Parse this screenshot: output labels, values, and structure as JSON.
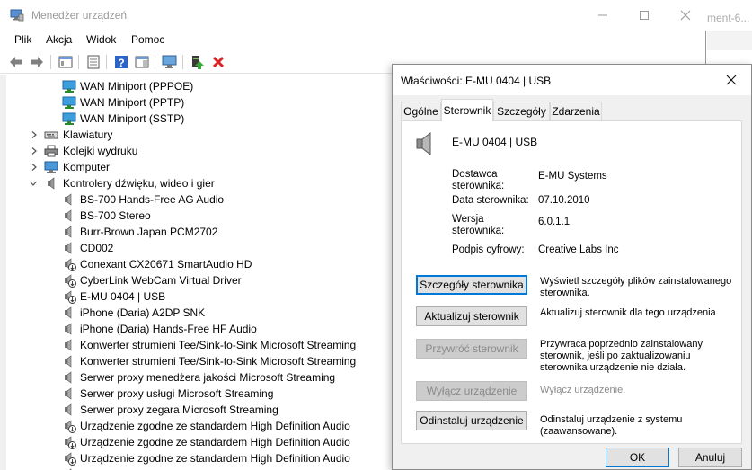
{
  "main_window": {
    "title": "Menedżer urządzeń",
    "menu": [
      "Plik",
      "Akcja",
      "Widok",
      "Pomoc"
    ]
  },
  "background_window": {
    "title": "ment-6..."
  },
  "tree": {
    "items": [
      {
        "label": "WAN Miniport (PPPOE)",
        "kind": "network"
      },
      {
        "label": "WAN Miniport (PPTP)",
        "kind": "network"
      },
      {
        "label": "WAN Miniport (SSTP)",
        "kind": "network"
      },
      {
        "label": "Klawiatury",
        "kind": "keyboard-category"
      },
      {
        "label": "Kolejki wydruku",
        "kind": "printer-category"
      },
      {
        "label": "Komputer",
        "kind": "computer-category"
      },
      {
        "label": "Kontrolery dźwięku, wideo i gier",
        "kind": "sound-category"
      },
      {
        "label": "BS-700 Hands-Free AG Audio",
        "kind": "speaker"
      },
      {
        "label": "BS-700 Stereo",
        "kind": "speaker"
      },
      {
        "label": "Burr-Brown Japan PCM2702",
        "kind": "speaker"
      },
      {
        "label": "CD002",
        "kind": "speaker"
      },
      {
        "label": "Conexant CX20671 SmartAudio HD",
        "kind": "speaker-download"
      },
      {
        "label": "CyberLink WebCam Virtual Driver",
        "kind": "speaker-download"
      },
      {
        "label": "E-MU 0404 | USB",
        "kind": "speaker-download"
      },
      {
        "label": "iPhone (Daria) A2DP SNK",
        "kind": "speaker"
      },
      {
        "label": "iPhone (Daria) Hands-Free HF Audio",
        "kind": "speaker"
      },
      {
        "label": "Konwerter strumieni Tee/Sink-to-Sink Microsoft Streaming",
        "kind": "speaker"
      },
      {
        "label": "Konwerter strumieni Tee/Sink-to-Sink Microsoft Streaming",
        "kind": "speaker"
      },
      {
        "label": "Serwer proxy menedżera jakości Microsoft Streaming",
        "kind": "speaker"
      },
      {
        "label": "Serwer proxy usługi Microsoft Streaming",
        "kind": "speaker"
      },
      {
        "label": "Serwer proxy zegara Microsoft Streaming",
        "kind": "speaker"
      },
      {
        "label": "Urządzenie zgodne ze standardem High Definition Audio",
        "kind": "speaker-download"
      },
      {
        "label": "Urządzenie zgodne ze standardem High Definition Audio",
        "kind": "speaker-download"
      },
      {
        "label": "Urządzenie zgodne ze standardem High Definition Audio",
        "kind": "speaker-download"
      },
      {
        "label": "",
        "kind": "speaker-download"
      }
    ]
  },
  "dialog": {
    "title": "Właściwości: E-MU 0404 | USB",
    "tabs": [
      "Ogólne",
      "Sterownik",
      "Szczegóły",
      "Zdarzenia"
    ],
    "active_tab": "Sterownik",
    "device_name": "E-MU 0404 | USB",
    "properties": {
      "provider_label": "Dostawca sterownika:",
      "provider_value": "E-MU Systems",
      "date_label": "Data sterownika:",
      "date_value": "07.10.2010",
      "version_label": "Wersja sterownika:",
      "version_value": "6.0.1.1",
      "signer_label": "Podpis cyfrowy:",
      "signer_value": "Creative Labs Inc"
    },
    "actions": {
      "details_label": "Szczegóły sterownika",
      "details_desc": "Wyświetl szczegóły plików zainstalowanego sterownika.",
      "update_label": "Aktualizuj sterownik",
      "update_desc": "Aktualizuj sterownik dla tego urządzenia",
      "rollback_label": "Przywróć sterownik",
      "rollback_desc": "Przywraca poprzednio zainstalowany sterownik, jeśli po zaktualizowaniu sterownika urządzenie nie działa.",
      "disable_label": "Wyłącz urządzenie",
      "disable_desc": "Wyłącz urządzenie.",
      "uninstall_label": "Odinstaluj urządzenie",
      "uninstall_desc": "Odinstaluj urządzenie z systemu (zaawansowane)."
    },
    "footer": {
      "ok_label": "OK",
      "cancel_label": "Anuluj"
    }
  }
}
